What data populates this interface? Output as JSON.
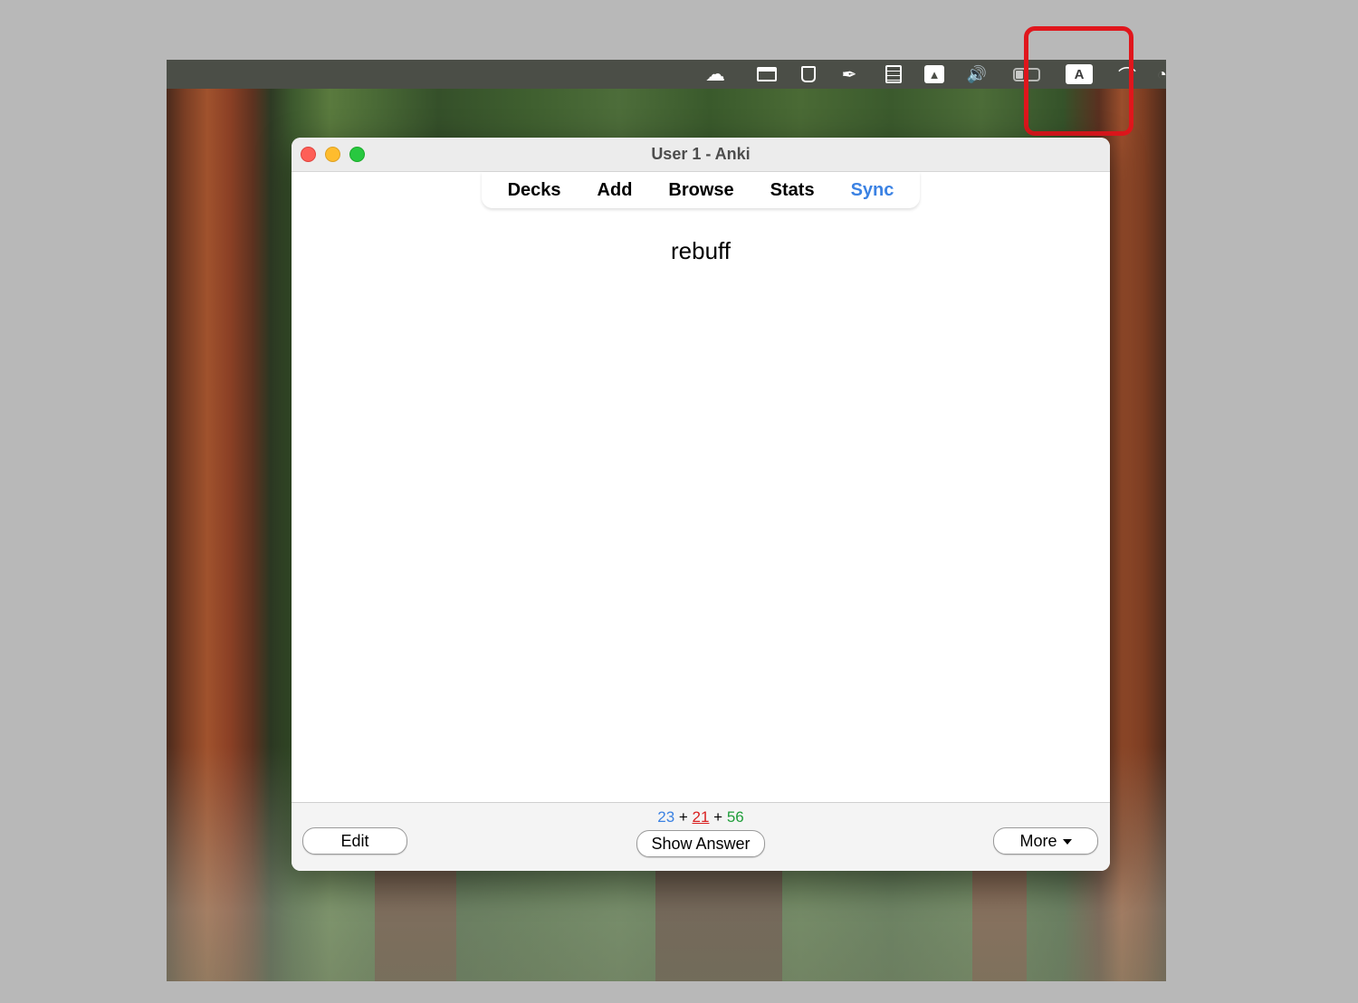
{
  "menubar": {
    "icons": [
      "cloud-icon",
      "window-icon",
      "cup-icon",
      "pen-icon",
      "clipboard-icon",
      "drive-icon",
      "volume-icon",
      "battery-icon",
      "input-source-icon",
      "wifi-icon"
    ],
    "input_source_label": "A"
  },
  "window": {
    "title": "User 1 - Anki"
  },
  "toolbar": {
    "decks": "Decks",
    "add": "Add",
    "browse": "Browse",
    "stats": "Stats",
    "sync": "Sync",
    "sync_color": "#3b82e3"
  },
  "card": {
    "front": "rebuff"
  },
  "bottom": {
    "edit_label": "Edit",
    "show_answer_label": "Show Answer",
    "more_label": "More",
    "counts": {
      "new": "23",
      "sep1": " + ",
      "learning": "21",
      "sep2": " + ",
      "review": "56"
    },
    "colors": {
      "new": "#3b82e3",
      "learning": "#d91f1f",
      "review": "#1f9e3a"
    }
  },
  "highlight_color": "#e0161c"
}
